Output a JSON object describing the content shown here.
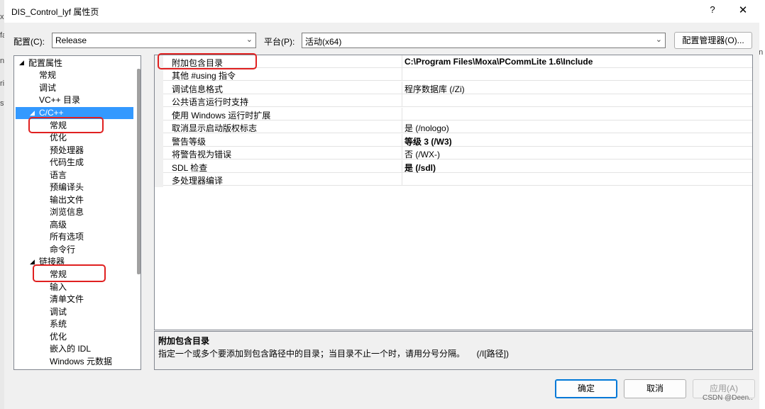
{
  "edge": {
    "left_frags": [
      "x",
      "fa",
      "nc",
      "ri",
      "st"
    ],
    "right_frags": [
      "en"
    ]
  },
  "window": {
    "title": "DIS_Control_lyf 属性页",
    "help": "?",
    "close": "✕"
  },
  "toolbar": {
    "config_label": "配置(C):",
    "config_value": "Release",
    "platform_label": "平台(P):",
    "platform_value": "活动(x64)",
    "config_manager": "配置管理器(O)..."
  },
  "tree": {
    "items": [
      "配置属性",
      "常规",
      "调试",
      "VC++ 目录",
      "C/C++",
      "常规",
      "优化",
      "预处理器",
      "代码生成",
      "语言",
      "预编译头",
      "输出文件",
      "浏览信息",
      "高级",
      "所有选项",
      "命令行",
      "链接器",
      "常规",
      "输入",
      "清单文件",
      "调试",
      "系统",
      "优化",
      "嵌入的 IDL",
      "Windows 元数据"
    ],
    "selected": "C/C++"
  },
  "grid": {
    "rows": [
      {
        "key": "附加包含目录",
        "value": "C:\\Program Files\\Moxa\\PCommLite 1.6\\Include",
        "bold": true
      },
      {
        "key": "其他 #using 指令",
        "value": "",
        "bold": false
      },
      {
        "key": "调试信息格式",
        "value": "程序数据库 (/Zi)",
        "bold": false
      },
      {
        "key": "公共语言运行时支持",
        "value": "",
        "bold": false
      },
      {
        "key": "使用 Windows 运行时扩展",
        "value": "",
        "bold": false
      },
      {
        "key": "取消显示启动版权标志",
        "value": "是 (/nologo)",
        "bold": false
      },
      {
        "key": "警告等级",
        "value": "等级 3 (/W3)",
        "bold": true
      },
      {
        "key": "将警告视为错误",
        "value": "否 (/WX-)",
        "bold": false
      },
      {
        "key": "SDL 检查",
        "value": "是 (/sdl)",
        "bold": true
      },
      {
        "key": "多处理器编译",
        "value": "",
        "bold": false
      }
    ]
  },
  "description": {
    "title": "附加包含目录",
    "text": "指定一个或多个要添加到包含路径中的目录；当目录不止一个时，请用分号分隔。     (/I[路径])"
  },
  "buttons": {
    "ok": "确定",
    "cancel": "取消",
    "apply": "应用(A)"
  },
  "watermark": "CSDN @Deen.."
}
